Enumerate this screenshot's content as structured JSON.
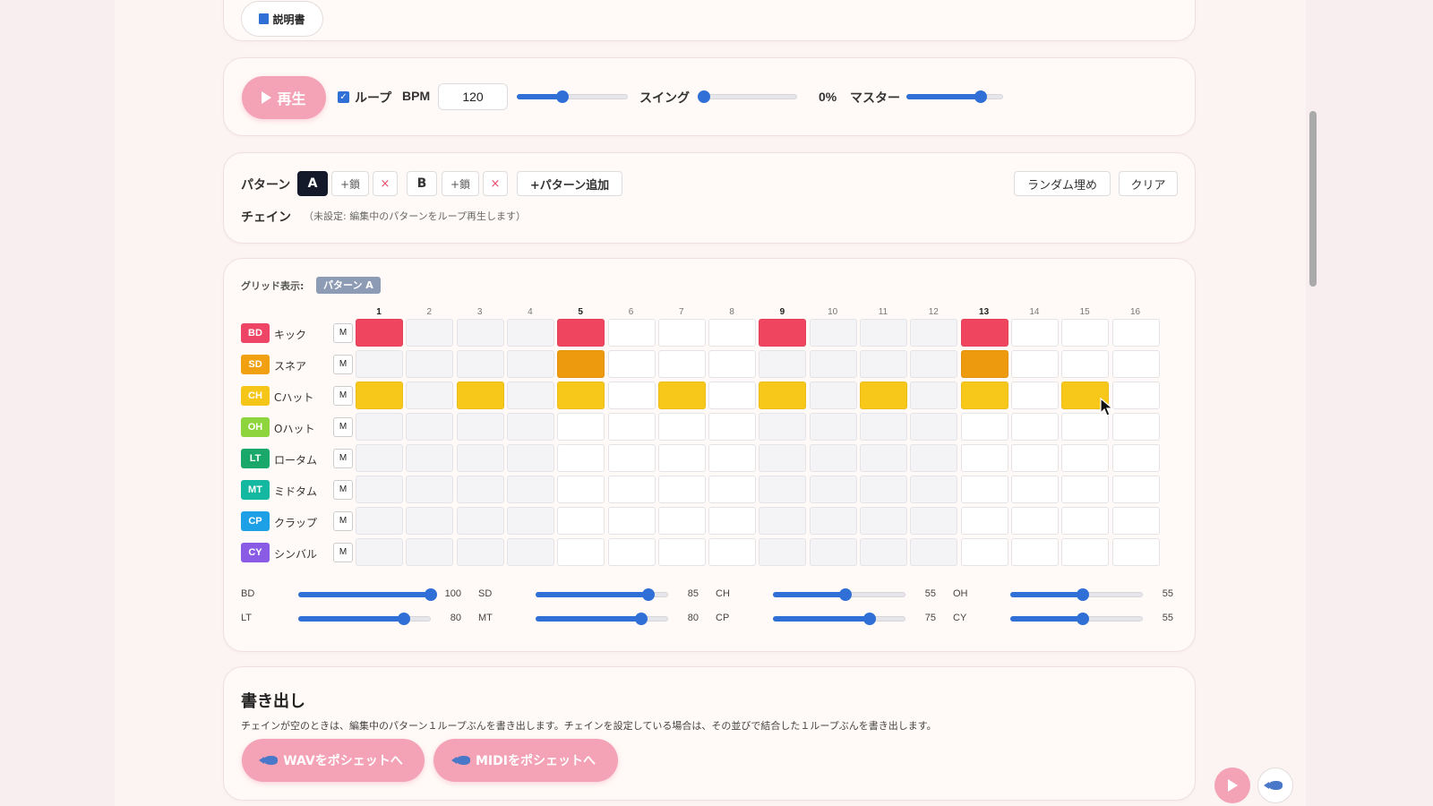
{
  "manual": {
    "label": "説明書",
    "icon": "book-icon"
  },
  "transport": {
    "play_label": "再生",
    "loop_label": "ループ",
    "loop_checked": true,
    "bpm_label": "BPM",
    "bpm_value": "120",
    "bpm_slider_fraction": 0.41,
    "swing_label": "スイング",
    "swing_value": "0%",
    "swing_slider_fraction": 0.0,
    "master_label": "マスター",
    "master_slider_fraction": 0.77
  },
  "patterns": {
    "label": "パターン",
    "items": [
      {
        "name": "A",
        "active": true,
        "chain_label": "+鎖",
        "delete_label": "×"
      },
      {
        "name": "B",
        "active": false,
        "chain_label": "+鎖",
        "delete_label": "×"
      }
    ],
    "add_label": "+パターン追加",
    "random_label": "ランダム埋め",
    "clear_label": "クリア",
    "chain_label": "チェイン",
    "chain_note": "（未設定: 編集中のパターンをループ再生します）"
  },
  "grid": {
    "display_label": "グリッド表示:",
    "display_tag": "パターン A",
    "steps": [
      "1",
      "2",
      "3",
      "4",
      "5",
      "6",
      "7",
      "8",
      "9",
      "10",
      "11",
      "12",
      "13",
      "14",
      "15",
      "16"
    ],
    "accent_steps": [
      1,
      5,
      9,
      13
    ],
    "tracks": [
      {
        "code": "BD",
        "name": "キック",
        "color": "#ee4466",
        "mute": "M",
        "steps": [
          1,
          0,
          0,
          0,
          1,
          0,
          0,
          0,
          1,
          0,
          0,
          0,
          1,
          0,
          0,
          0
        ]
      },
      {
        "code": "SD",
        "name": "スネア",
        "color": "#f0a010",
        "mute": "M",
        "steps": [
          0,
          0,
          0,
          0,
          1,
          0,
          0,
          0,
          0,
          0,
          0,
          0,
          1,
          0,
          0,
          0
        ]
      },
      {
        "code": "CH",
        "name": "Cハット",
        "color": "#f5c518",
        "mute": "M",
        "steps": [
          1,
          0,
          1,
          0,
          1,
          0,
          1,
          0,
          1,
          0,
          1,
          0,
          1,
          0,
          1,
          0
        ]
      },
      {
        "code": "OH",
        "name": "Oハット",
        "color": "#8ed43c",
        "mute": "M",
        "steps": [
          0,
          0,
          0,
          0,
          0,
          0,
          0,
          0,
          0,
          0,
          0,
          0,
          0,
          0,
          0,
          0
        ]
      },
      {
        "code": "LT",
        "name": "ロータム",
        "color": "#1aa86a",
        "mute": "M",
        "steps": [
          0,
          0,
          0,
          0,
          0,
          0,
          0,
          0,
          0,
          0,
          0,
          0,
          0,
          0,
          0,
          0
        ]
      },
      {
        "code": "MT",
        "name": "ミドタム",
        "color": "#14b8a0",
        "mute": "M",
        "steps": [
          0,
          0,
          0,
          0,
          0,
          0,
          0,
          0,
          0,
          0,
          0,
          0,
          0,
          0,
          0,
          0
        ]
      },
      {
        "code": "CP",
        "name": "クラップ",
        "color": "#1ea0e6",
        "mute": "M",
        "steps": [
          0,
          0,
          0,
          0,
          0,
          0,
          0,
          0,
          0,
          0,
          0,
          0,
          0,
          0,
          0,
          0
        ]
      },
      {
        "code": "CY",
        "name": "シンバル",
        "color": "#8a5ce6",
        "mute": "M",
        "steps": [
          0,
          0,
          0,
          0,
          0,
          0,
          0,
          0,
          0,
          0,
          0,
          0,
          0,
          0,
          0,
          0
        ]
      }
    ],
    "active_colors": {
      "BD": "#f0455f",
      "SD": "#ee9a0e",
      "CH": "#f7c81a"
    },
    "volumes": [
      {
        "code": "BD",
        "value": "100",
        "fraction": 1.0
      },
      {
        "code": "SD",
        "value": "85",
        "fraction": 0.85
      },
      {
        "code": "CH",
        "value": "55",
        "fraction": 0.55
      },
      {
        "code": "OH",
        "value": "55",
        "fraction": 0.55
      },
      {
        "code": "LT",
        "value": "80",
        "fraction": 0.8
      },
      {
        "code": "MT",
        "value": "80",
        "fraction": 0.8
      },
      {
        "code": "CP",
        "value": "75",
        "fraction": 0.73
      },
      {
        "code": "CY",
        "value": "55",
        "fraction": 0.55
      }
    ]
  },
  "export": {
    "title": "書き出し",
    "description": "チェインが空のときは、編集中のパターン１ループぶんを書き出します。チェインを設定している場合は、その並びで結合した１ループぶんを書き出します。",
    "wav_label": "WAVをポシェットへ",
    "midi_label": "MIDIをポシェットへ"
  },
  "colors": {
    "accent": "#2f6fd6",
    "pink": "#f4a2b5"
  }
}
